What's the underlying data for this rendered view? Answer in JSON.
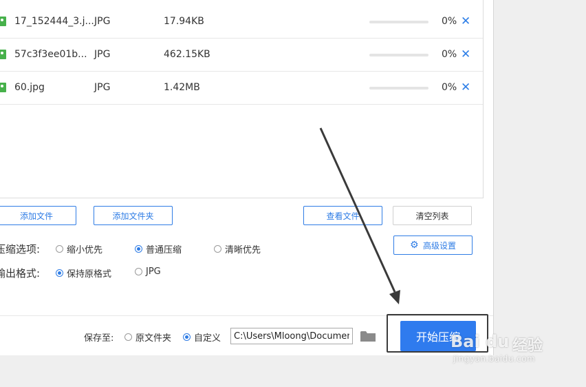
{
  "files": [
    {
      "name": "17_152444_3.j...",
      "type": "JPG",
      "size": "17.94KB",
      "progress": 0,
      "percent": "0%",
      "remove_icon": "close-icon"
    },
    {
      "name": "57c3f3ee01b...",
      "type": "JPG",
      "size": "462.15KB",
      "progress": 0,
      "percent": "0%",
      "remove_icon": "close-icon"
    },
    {
      "name": "60.jpg",
      "type": "JPG",
      "size": "1.42MB",
      "progress": 0,
      "percent": "0%",
      "remove_icon": "close-icon"
    }
  ],
  "toolbar": {
    "add_file": "添加文件",
    "add_folder": "添加文件夹",
    "view_file": "查看文件",
    "clear_list": "清空列表",
    "advanced": "高级设置"
  },
  "compress_options": {
    "label": "压缩选项:",
    "options": [
      "缩小优先",
      "普通压缩",
      "清晰优先"
    ],
    "selected": "普通压缩"
  },
  "output_format": {
    "label": "输出格式:",
    "options": [
      "保持原格式",
      "JPG"
    ],
    "selected": "保持原格式"
  },
  "save": {
    "label": "保存至:",
    "options": [
      "原文件夹",
      "自定义"
    ],
    "selected": "自定义",
    "path": "C:\\Users\\Mloong\\Documents"
  },
  "start_button": "开始压缩",
  "watermark": {
    "brand": "Bai du",
    "word": "经验",
    "url": "jingyan.baidu.com"
  },
  "colors": {
    "accent": "#2f7bee",
    "link_blue": "#2e7ce5",
    "file_icon": "#47b14b",
    "annotation": "#3a3a3a"
  }
}
